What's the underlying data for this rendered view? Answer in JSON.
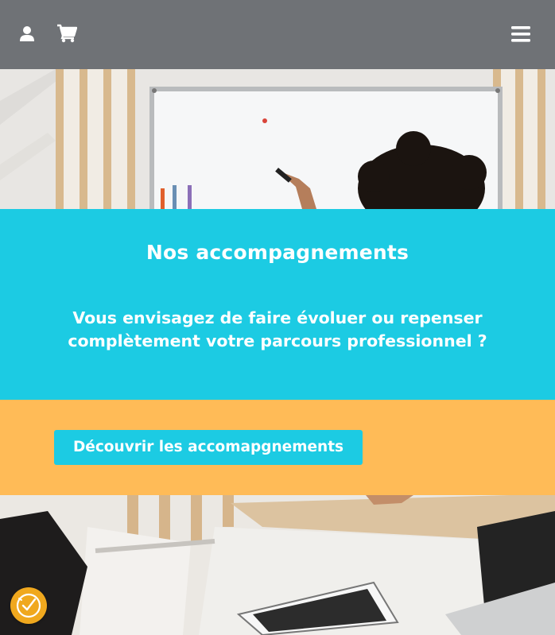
{
  "header": {
    "icons": [
      "user-icon",
      "cart-icon",
      "hamburger-menu-icon"
    ],
    "background": "#6f7276"
  },
  "section": {
    "title": "Nos accompagnements",
    "subtitle": "Vous envisagez de faire évoluer ou repenser complètement votre parcours professionnel ?"
  },
  "cta": {
    "label": "Découvrir les accomapgnements"
  },
  "colors": {
    "cyan": "#1ccbe3",
    "orange": "#ffbb57",
    "consent": "#f0a81e"
  },
  "consent": {
    "icon": "consent-check-icon"
  }
}
